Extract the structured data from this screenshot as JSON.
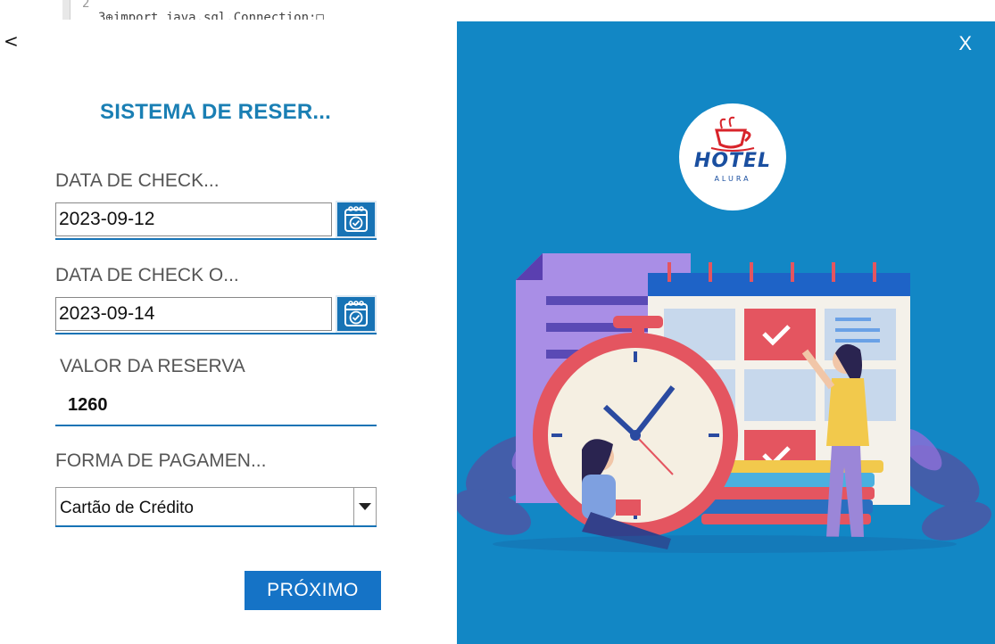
{
  "editor": {
    "line_number": "2",
    "code_line": "3⊕import java.sql.Connection;□"
  },
  "nav": {
    "back_glyph": "<"
  },
  "form": {
    "title": "SISTEMA DE RESER...",
    "check_in": {
      "label": "DATA DE CHECK...",
      "value": "2023-09-12",
      "icon": "calendar-check-icon"
    },
    "check_out": {
      "label": "DATA DE CHECK O...",
      "value": "2023-09-14",
      "icon": "calendar-check-icon"
    },
    "valor": {
      "label": "VALOR DA RESERVA",
      "value": "1260"
    },
    "pagamento": {
      "label": "FORMA DE PAGAMEN...",
      "selected": "Cartão de Crédito"
    },
    "next_button": "PRÓXIMO"
  },
  "panel": {
    "close_label": "X",
    "logo_text": "HOTEL",
    "logo_subtext": "ALURA",
    "background_color": "#1287c5"
  },
  "colors": {
    "accent": "#1773b5",
    "title": "#1a7fb4",
    "button": "#1573c6"
  }
}
